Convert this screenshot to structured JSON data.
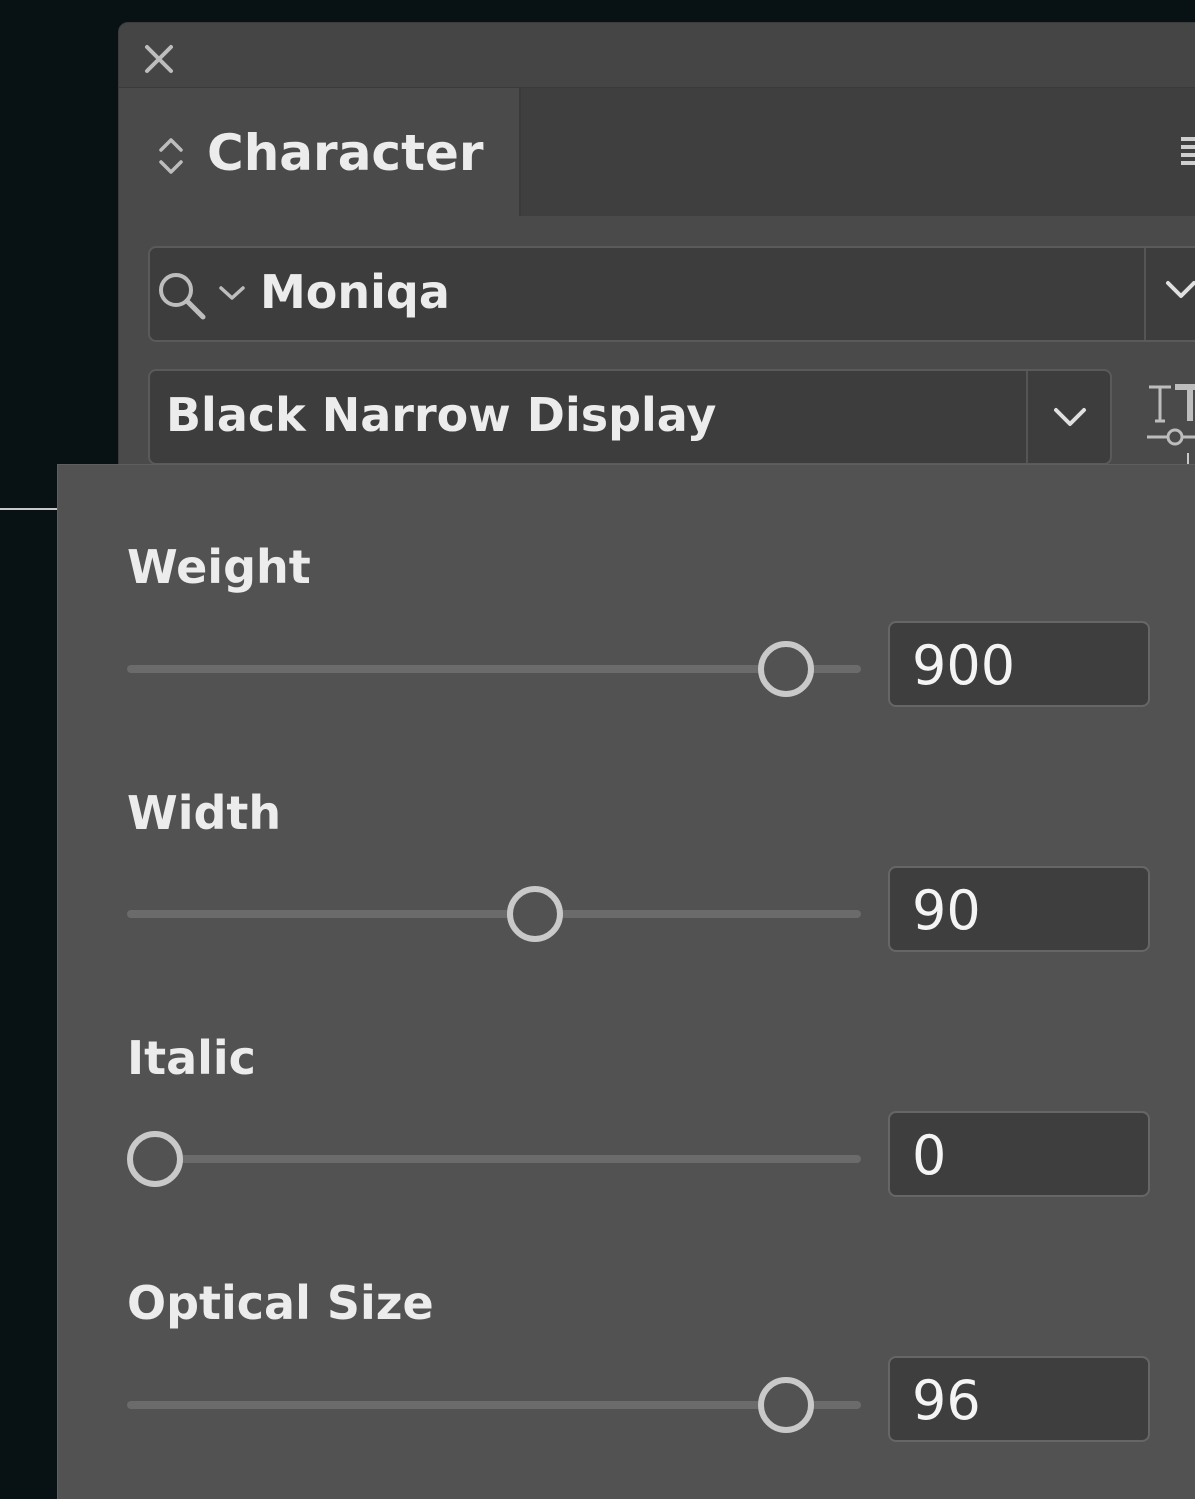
{
  "panel": {
    "tab_label": "Character",
    "font_family": "Moniqa",
    "font_style": "Black Narrow Display"
  },
  "icons": {
    "close": "close-icon",
    "tab_arrows": "up-down-arrows-icon",
    "panel_menu": "hamburger-menu-icon",
    "search": "search-icon",
    "dropdown": "chevron-down-icon",
    "variable_font": "variable-font-axes-icon"
  },
  "axes": [
    {
      "label": "Weight",
      "value": "900",
      "level": 0.93
    },
    {
      "label": "Width",
      "value": "90",
      "level": 0.56
    },
    {
      "label": "Italic",
      "value": "0",
      "level": 0.0
    },
    {
      "label": "Optical Size",
      "value": "96",
      "level": 0.93
    }
  ],
  "colors": {
    "background": "#081114",
    "panel": "#4a4a4a",
    "popover": "#525252",
    "field": "#3e3e3e",
    "text": "#ececec"
  }
}
